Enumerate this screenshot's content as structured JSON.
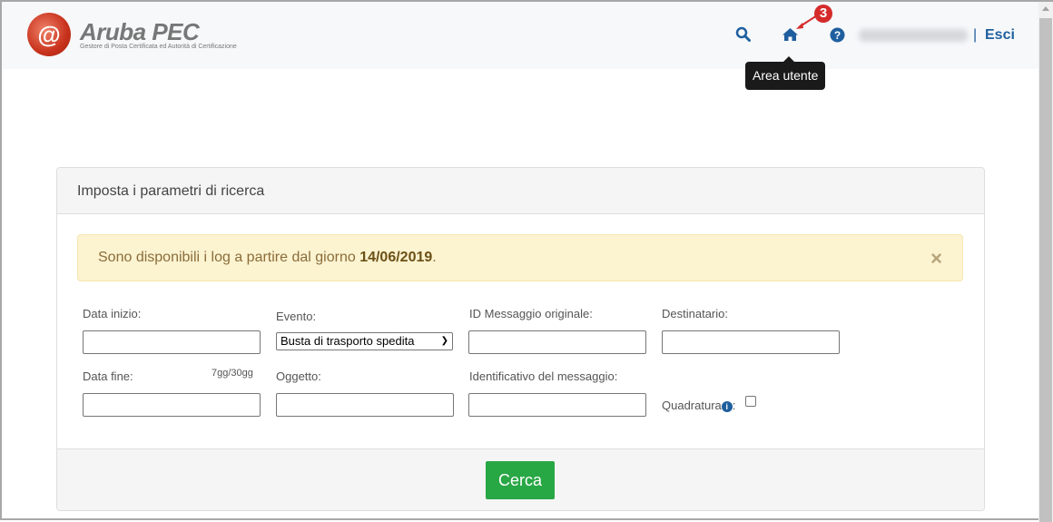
{
  "header": {
    "brand": "Aruba PEC",
    "tagline": "Gestore di Posta Certificata ed Autorità di Certificazione",
    "logout": "Esci",
    "separator": "|",
    "tooltip": "Area utente",
    "step_badge": "3"
  },
  "panel": {
    "title": "Imposta i parametri di ricerca",
    "alert": {
      "text": "Sono disponibili i log a partire dal giorno ",
      "date": "14/06/2019",
      "end": ".",
      "close": "×"
    },
    "fields": {
      "data_inizio": "Data inizio:",
      "evento": "Evento:",
      "evento_value": "Busta di trasporto spedita",
      "id_msg": "ID Messaggio originale:",
      "destinatario": "Destinatario:",
      "data_fine": "Data fine:",
      "range_hint": "7gg/30gg",
      "oggetto": "Oggetto:",
      "identificativo": "Identificativo del messaggio:",
      "quadratura": "Quadratura",
      "colon": ":"
    },
    "search_button": "Cerca"
  },
  "colors": {
    "accent": "#1f5f9f",
    "button": "#28a745",
    "alert_bg": "#fcf3d0"
  }
}
